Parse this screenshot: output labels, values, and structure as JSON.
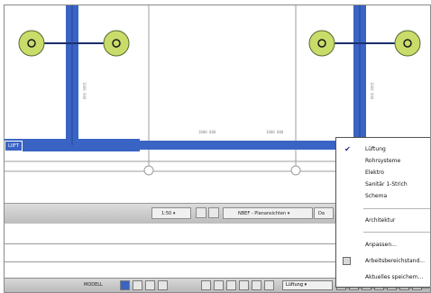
{
  "canvas": {
    "wall_labels": [
      "1000 000",
      "1000 000",
      "1000 000",
      "1000 000"
    ],
    "pipe_tag": "LUFT"
  },
  "viewbar": {
    "scale": "1:50",
    "detail_level": "NBEF - Planansichten",
    "discipline_short": "Da"
  },
  "statusbar": {
    "mode": "MODELL",
    "discipline": "Lüftung"
  },
  "menu": {
    "disciplines": [
      {
        "label": "Lüftung",
        "checked": true
      },
      {
        "label": "Rohrsysteme",
        "checked": false
      },
      {
        "label": "Elektro",
        "checked": false
      },
      {
        "label": "Sanitär 1-Strich",
        "checked": false
      },
      {
        "label": "Schema",
        "checked": false
      }
    ],
    "architecture": "Architektur",
    "adjust": "Anpassen...",
    "workspace": "Arbeitsbereichstand...",
    "save_current": "Aktuelles speichern..."
  },
  "colors": {
    "pipe": "#3a64c4",
    "terminal": "#c9dc6a",
    "terminal_stroke": "#556b2f",
    "check": "#1a1a8a"
  },
  "icons": {
    "check": "checkmark-icon",
    "workspace": "workspace-icon",
    "air-terminal": "air-terminal-icon"
  }
}
